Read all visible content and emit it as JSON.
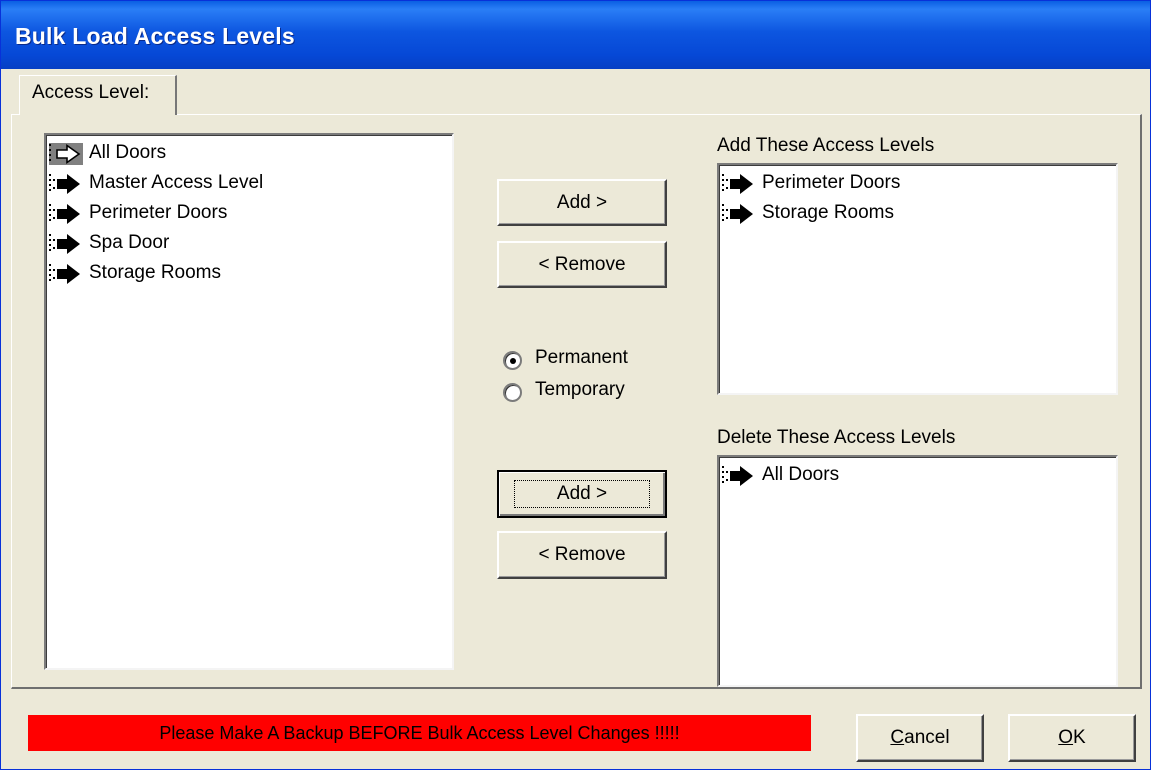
{
  "window": {
    "title": "Bulk Load Access Levels"
  },
  "tab": {
    "label": "Access Level:"
  },
  "available_list": {
    "items": [
      {
        "label": "All Doors",
        "selected": true
      },
      {
        "label": "Master Access Level"
      },
      {
        "label": "Perimeter Doors"
      },
      {
        "label": "Spa Door"
      },
      {
        "label": "Storage Rooms"
      }
    ]
  },
  "add_section": {
    "heading": "Add These Access Levels",
    "add_label": "Add >",
    "remove_label": "< Remove",
    "items": [
      {
        "label": "Perimeter Doors"
      },
      {
        "label": "Storage Rooms"
      }
    ]
  },
  "options": {
    "permanent_label": "Permanent",
    "temporary_label": "Temporary",
    "selected": "Permanent"
  },
  "delete_section": {
    "heading": "Delete These Access Levels",
    "add_label": "Add >",
    "remove_label": "< Remove",
    "items": [
      {
        "label": "All Doors"
      }
    ]
  },
  "footer": {
    "warning": "Please Make A Backup BEFORE Bulk Access Level Changes !!!!!",
    "cancel_mnemonic": "C",
    "cancel_rest": "ancel",
    "ok_mnemonic": "O",
    "ok_rest": "K"
  },
  "colors": {
    "titlebar": "#0a5fe3",
    "face": "#ece9d8",
    "warning_bg": "#ff0000"
  },
  "icons": {
    "list_item": "arrow-right-icon",
    "selected_item": "arrow-right-outline-icon"
  }
}
